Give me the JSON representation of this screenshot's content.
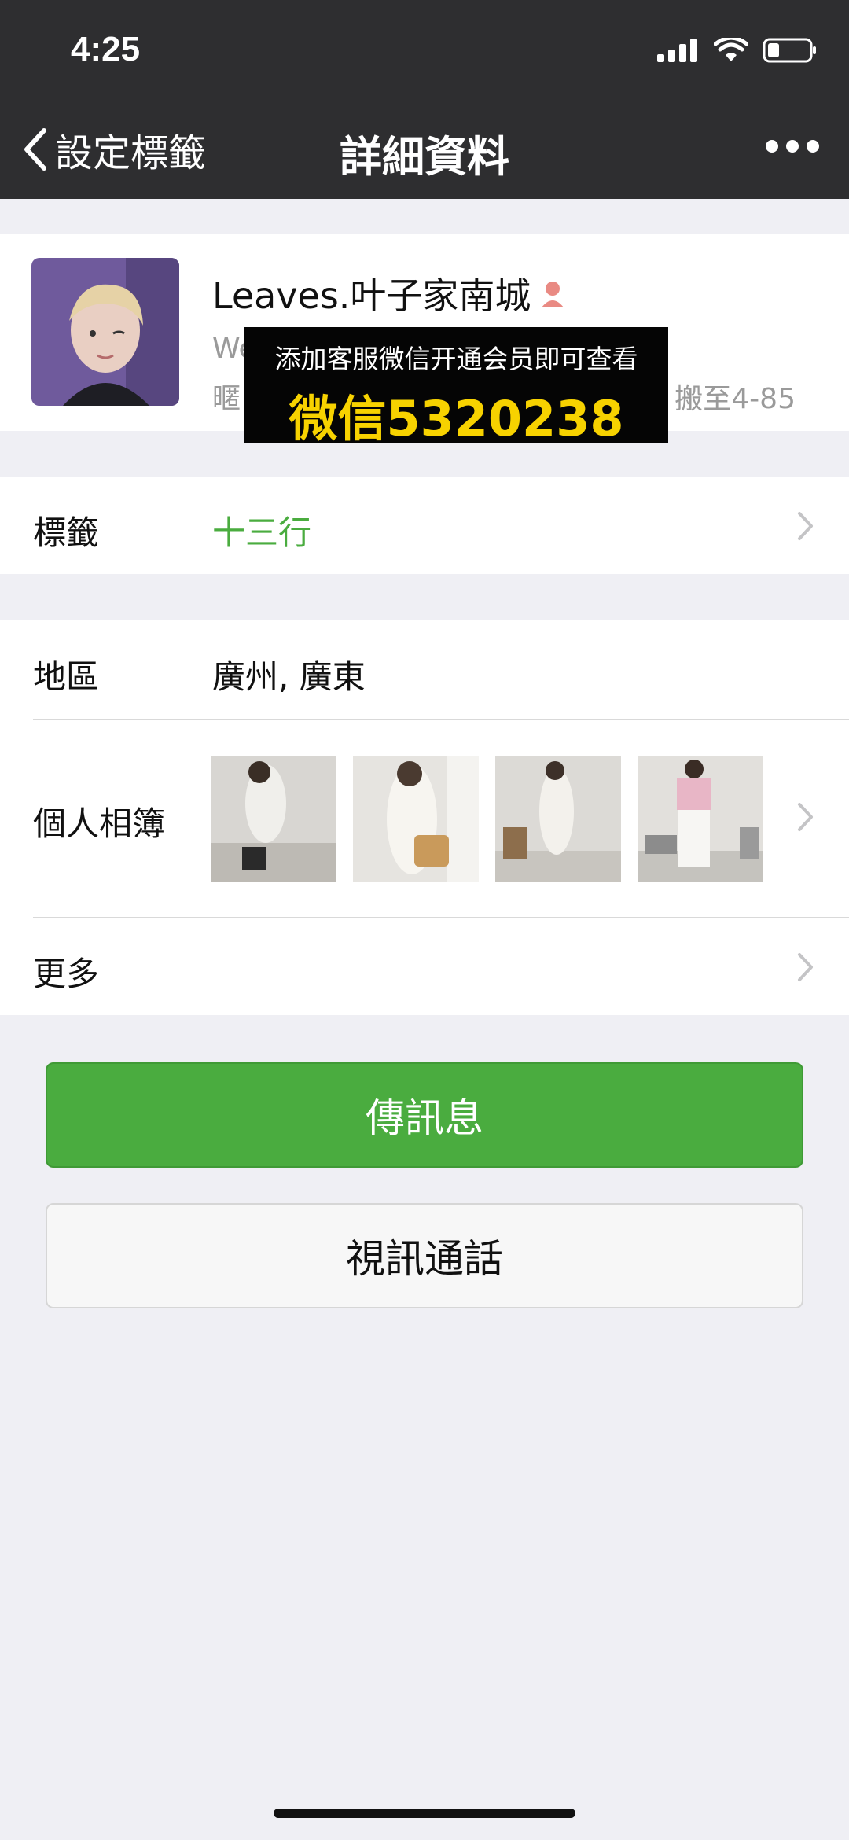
{
  "status_bar": {
    "time": "4:25"
  },
  "nav": {
    "back_label": "設定標籤",
    "title": "詳細資料"
  },
  "profile": {
    "name": "Leaves.叶子家南城",
    "wechat_id_prefix": "We",
    "region_prefix": "暱",
    "line2_right": "搬至4-85"
  },
  "overlay": {
    "line1": "添加客服微信开通会员即可查看",
    "line2": "微信5320238"
  },
  "tag_row": {
    "label": "標籤",
    "value": "十三行"
  },
  "region_row": {
    "label": "地區",
    "value": "廣州, 廣東"
  },
  "album_row": {
    "label": "個人相簿"
  },
  "more_row": {
    "label": "更多"
  },
  "buttons": {
    "send_message": "傳訊息",
    "video_call": "視訊通話"
  },
  "colors": {
    "accent_green": "#4aac3f",
    "tag_green": "#4aac3f",
    "nav_bg": "#2e2e30",
    "overlay_text": "#f7d200"
  },
  "icons": [
    "back-chevron-icon",
    "more-dots-icon",
    "signal-icon",
    "wifi-icon",
    "battery-icon",
    "female-icon",
    "chevron-right-icon"
  ]
}
